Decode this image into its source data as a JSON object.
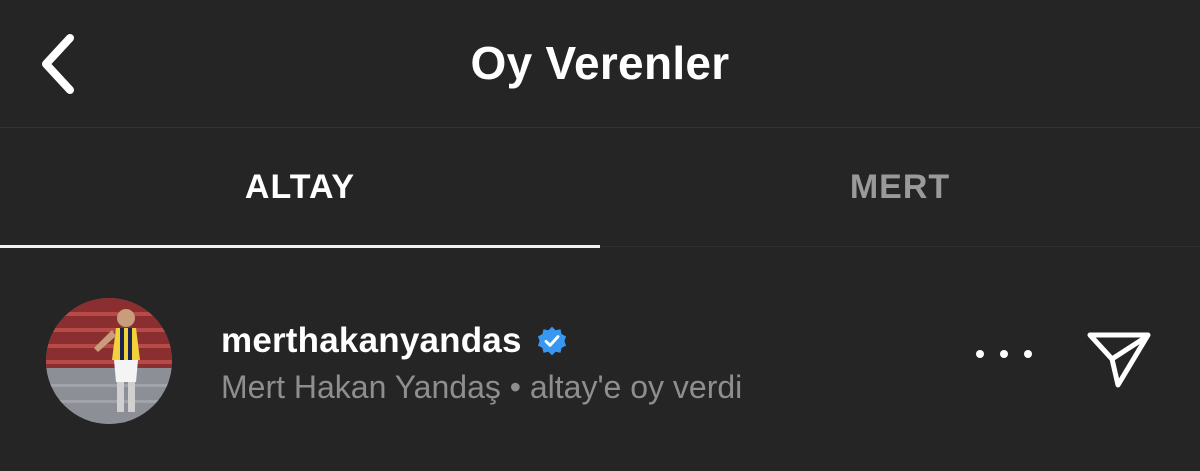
{
  "header": {
    "title": "Oy Verenler",
    "back_icon": "chevron-left-icon"
  },
  "tabs": [
    {
      "label": "ALTAY",
      "active": true
    },
    {
      "label": "MERT",
      "active": false
    }
  ],
  "voters": [
    {
      "username": "merthakanyandas",
      "verified": true,
      "subtitle": "Mert Hakan Yandaş • altay'e oy verdi",
      "avatar": "profile-photo"
    }
  ],
  "actions": {
    "more_icon": "ellipsis-icon",
    "send_icon": "paper-plane-icon"
  },
  "colors": {
    "background": "#252525",
    "text_primary": "#ffffff",
    "text_secondary": "#8e8e8e",
    "verified_blue": "#3897f0"
  }
}
